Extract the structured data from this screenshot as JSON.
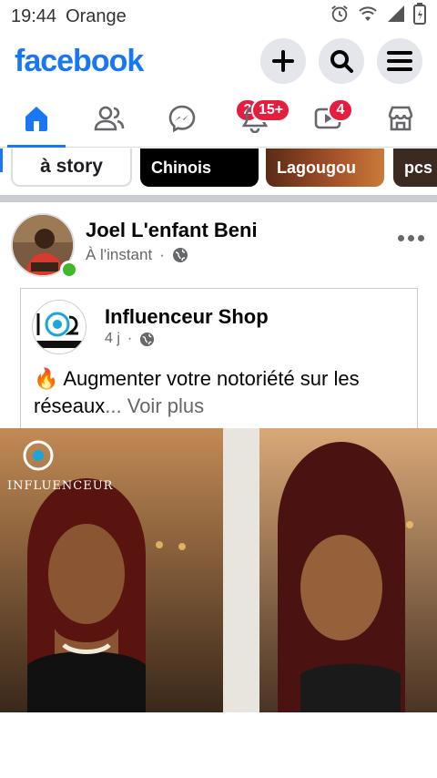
{
  "status": {
    "time": "19:44",
    "carrier": "Orange"
  },
  "header": {
    "logo": "facebook"
  },
  "tabs": [
    {
      "name": "home",
      "badge": ""
    },
    {
      "name": "friends",
      "badge": ""
    },
    {
      "name": "messenger",
      "badge": "2"
    },
    {
      "name": "notifications",
      "badge": "15+"
    },
    {
      "name": "watch",
      "badge": "4"
    },
    {
      "name": "marketplace",
      "badge": ""
    }
  ],
  "stories": {
    "create_label": "à story",
    "items": [
      "Chinois",
      "Lagougou",
      "pcs"
    ]
  },
  "post": {
    "author": "Joel L'enfant Beni",
    "time": "À l'instant",
    "shared": {
      "page_name": "Influenceur Shop",
      "time": "4 j",
      "emoji": "🔥",
      "text": "Augmenter votre notoriété sur les réseaux",
      "see_more": "... Voir plus",
      "image_watermark": "INFLUENCEUR"
    }
  },
  "colors": {
    "brand": "#1877f2",
    "badge": "#e41e3f",
    "online": "#42b72a"
  }
}
